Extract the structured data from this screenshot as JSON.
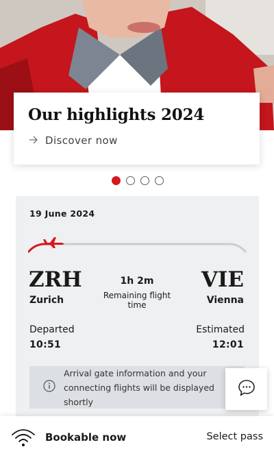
{
  "hero": {
    "title": "Our highlights 2024",
    "link_label": "Discover now"
  },
  "carousel": {
    "count": 4,
    "active_index": 0
  },
  "flight": {
    "date": "19 June 2024",
    "origin": {
      "code": "ZRH",
      "city": "Zurich",
      "status_label": "Departed",
      "time": "10:51"
    },
    "destination": {
      "code": "VIE",
      "city": "Vienna",
      "status_label": "Estimated",
      "time": "12:01"
    },
    "duration": "1h 2m",
    "duration_caption": "Remaining flight time",
    "progress": 0.12,
    "info_text_line1": "Arrival gate information and your",
    "info_text_line2": "connecting flights will be displayed shortly"
  },
  "bottom_bar": {
    "label": "Bookable now",
    "action": "Select pass"
  },
  "colors": {
    "accent": "#d7191d",
    "card_bg": "#eff0f2",
    "info_bg": "#dcdfe3"
  },
  "icons": {
    "link": "arrow-right-icon",
    "plane": "airplane-icon",
    "info": "info-icon",
    "chat": "chat-bubble-icon",
    "wifi": "wifi-icon"
  }
}
